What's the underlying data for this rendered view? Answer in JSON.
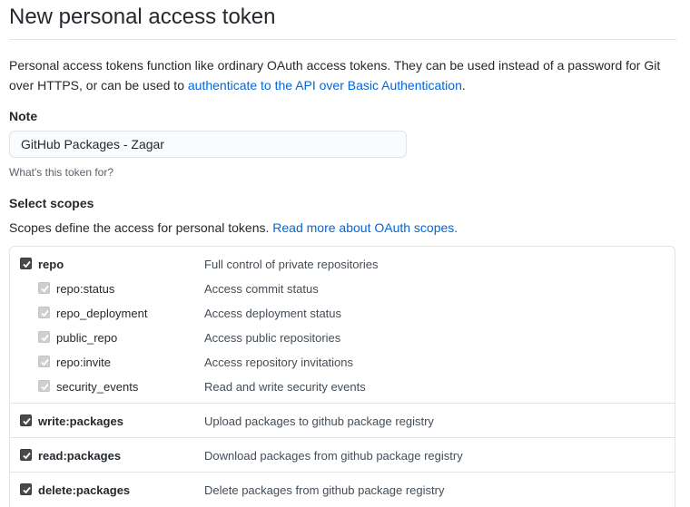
{
  "header": {
    "title": "New personal access token"
  },
  "intro": {
    "text_before": "Personal access tokens function like ordinary OAuth access tokens. They can be used instead of a password for Git over HTTPS, or can be used to ",
    "link": "authenticate to the API over Basic Authentication",
    "text_after": "."
  },
  "note": {
    "label": "Note",
    "value": "GitHub Packages - Zagar",
    "hint": "What's this token for?"
  },
  "scopes": {
    "label": "Select scopes",
    "desc_text": "Scopes define the access for personal tokens. ",
    "desc_link": "Read more about OAuth scopes.",
    "repo": {
      "name": "repo",
      "desc": "Full control of private repositories",
      "checked": true,
      "children": [
        {
          "name": "repo:status",
          "desc": "Access commit status"
        },
        {
          "name": "repo_deployment",
          "desc": "Access deployment status"
        },
        {
          "name": "public_repo",
          "desc": "Access public repositories"
        },
        {
          "name": "repo:invite",
          "desc": "Access repository invitations"
        },
        {
          "name": "security_events",
          "desc": "Read and write security events"
        }
      ]
    },
    "write_packages": {
      "name": "write:packages",
      "desc": "Upload packages to github package registry",
      "checked": true
    },
    "read_packages": {
      "name": "read:packages",
      "desc": "Download packages from github package registry",
      "checked": true
    },
    "delete_packages": {
      "name": "delete:packages",
      "desc": "Delete packages from github package registry",
      "checked": true
    }
  },
  "colors": {
    "link": "#0366d6",
    "border": "#e1e4e8",
    "checkbox_checked": "#4a4a4a",
    "checkbox_disabled": "#cfcfcf"
  }
}
